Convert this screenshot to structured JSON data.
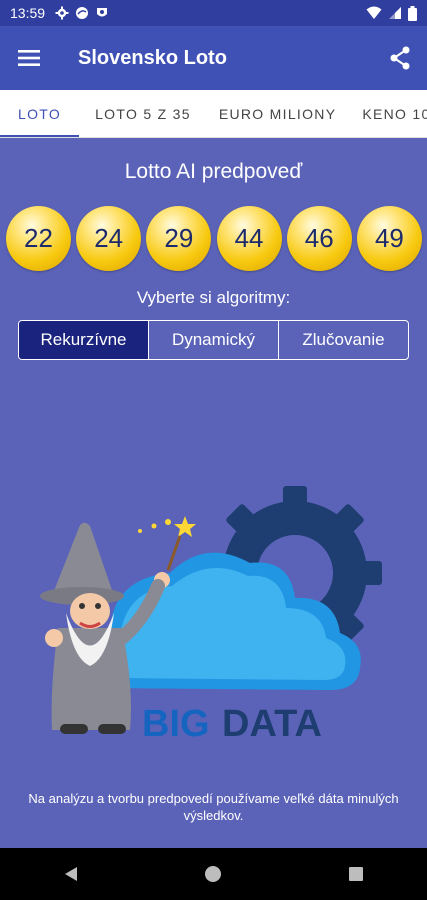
{
  "status": {
    "time": "13:59"
  },
  "appbar": {
    "title": "Slovensko Loto"
  },
  "tabs": [
    {
      "label": "LOTO",
      "active": true
    },
    {
      "label": "LOTO 5 Z 35",
      "active": false
    },
    {
      "label": "EURO MILIONY",
      "active": false
    },
    {
      "label": "KENO 10",
      "active": false
    }
  ],
  "main": {
    "heading": "Lotto AI predpoveď",
    "numbers": [
      "22",
      "24",
      "29",
      "44",
      "46",
      "49"
    ],
    "subheading": "Vyberte si algoritmy:",
    "algorithms": [
      {
        "label": "Rekurzívne",
        "selected": true
      },
      {
        "label": "Dynamický",
        "selected": false
      },
      {
        "label": "Zlučovanie",
        "selected": false
      }
    ],
    "illustration": {
      "text_big": "BIG",
      "text_data": "DATA"
    },
    "caption": "Na analýzu a tvorbu predpovedí používame veľké dáta minulých výsledkov."
  },
  "colors": {
    "primary": "#3f51b5",
    "background": "#5b63b8",
    "selected_segment": "#1a237e",
    "ball": "#f7c90f"
  }
}
